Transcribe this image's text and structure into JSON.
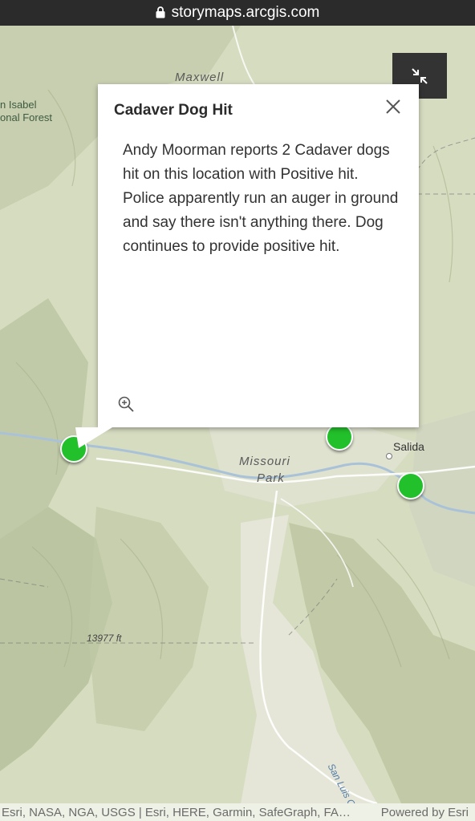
{
  "browser": {
    "url": "storymaps.arcgis.com"
  },
  "map": {
    "labels": {
      "maxwell": "Maxwell",
      "forest_line1": "n Isabel",
      "forest_line2": "onal Forest",
      "missouri_line1": "Missouri",
      "missouri_line2": "Park",
      "salida": "Salida",
      "elevation": "13977 ft",
      "creek": "San Luis Creek"
    },
    "markers": [
      "marker-1",
      "marker-2",
      "marker-3"
    ],
    "marker_color": "#22c02a"
  },
  "popup": {
    "title": "Cadaver Dog Hit",
    "body": "Andy Moorman reports 2 Cadaver dogs hit on this location with Positive hit. Police apparently run an auger in ground and say there isn't anything there. Dog continues to provide positive hit.",
    "close_icon": "close-icon",
    "zoom_icon": "zoom-in-icon"
  },
  "controls": {
    "collapse_icon": "collapse-icon"
  },
  "attribution": {
    "credits": "Esri, NASA, NGA, USGS | Esri, HERE, Garmin, SafeGraph, FAO, METI/NASA, USGS, Bureau of Land Management, EPA, NPS",
    "powered_by": "Powered by Esri"
  }
}
